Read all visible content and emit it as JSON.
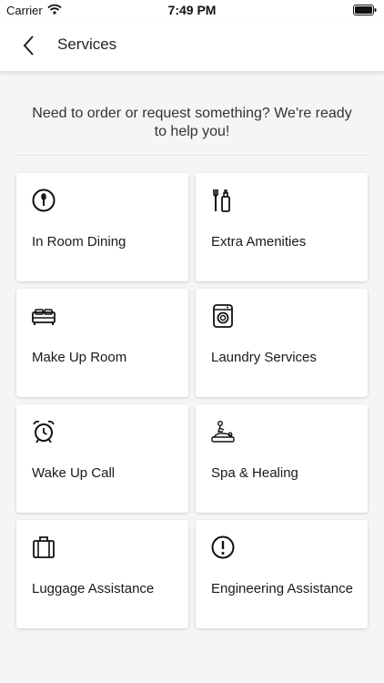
{
  "status_bar": {
    "carrier": "Carrier",
    "time": "7:49 PM",
    "icons": [
      "wifi-icon",
      "battery-icon"
    ]
  },
  "nav": {
    "title": "Services",
    "back_icon": "chevron-left-icon"
  },
  "intro_text": "Need to order or request something? We're ready to help you!",
  "services": [
    {
      "label": "In Room Dining",
      "icon": "dining-icon"
    },
    {
      "label": "Extra Amenities",
      "icon": "amenities-icon"
    },
    {
      "label": "Make Up Room",
      "icon": "bed-icon"
    },
    {
      "label": "Laundry Services",
      "icon": "washing-machine-icon"
    },
    {
      "label": "Wake Up Call",
      "icon": "alarm-clock-icon"
    },
    {
      "label": "Spa & Healing",
      "icon": "spa-massage-icon"
    },
    {
      "label": "Luggage Assistance",
      "icon": "luggage-icon"
    },
    {
      "label": "Engineering Assistance",
      "icon": "alert-circle-icon"
    }
  ]
}
